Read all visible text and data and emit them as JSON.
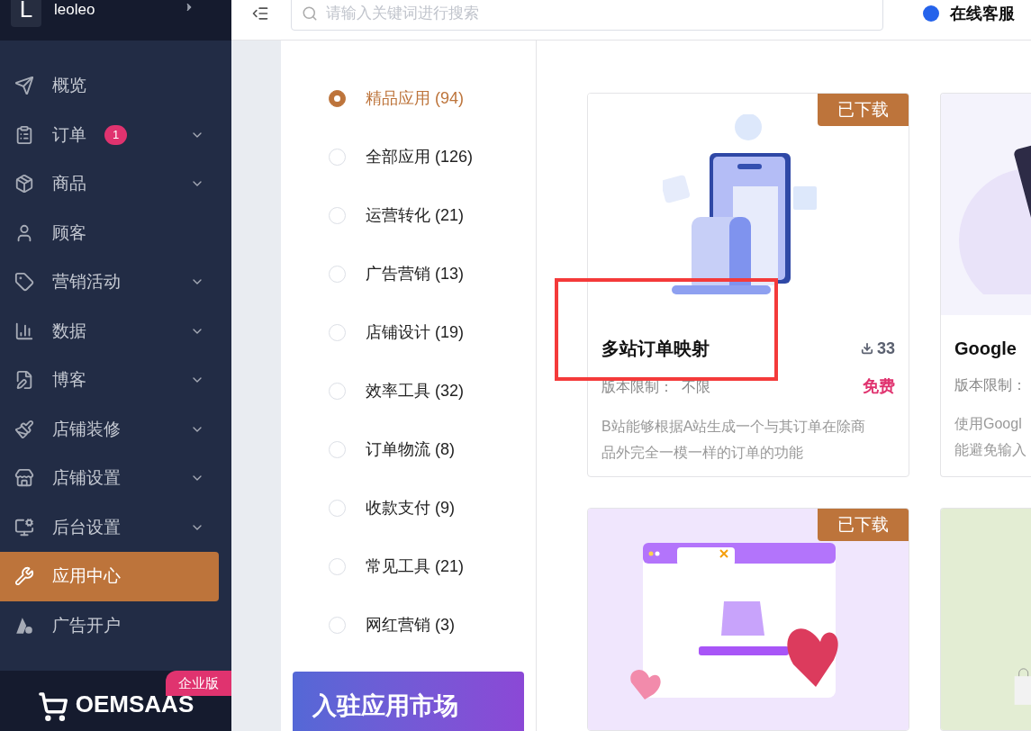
{
  "sidebar": {
    "brand": {
      "initial": "L",
      "name": "leoleo"
    },
    "items": [
      {
        "label": "概览",
        "expandable": false,
        "selected": false
      },
      {
        "label": "订单",
        "badge": "1",
        "expandable": true,
        "selected": false
      },
      {
        "label": "商品",
        "expandable": true,
        "selected": false
      },
      {
        "label": "顾客",
        "expandable": false,
        "selected": false
      },
      {
        "label": "营销活动",
        "expandable": true,
        "selected": false
      },
      {
        "label": "数据",
        "expandable": true,
        "selected": false
      },
      {
        "label": "博客",
        "expandable": true,
        "selected": false
      },
      {
        "label": "店铺装修",
        "expandable": true,
        "selected": false
      },
      {
        "label": "店铺设置",
        "expandable": true,
        "selected": false
      },
      {
        "label": "后台设置",
        "expandable": true,
        "selected": false
      },
      {
        "label": "应用中心",
        "expandable": false,
        "selected": true
      },
      {
        "label": "广告开户",
        "expandable": false,
        "selected": false
      }
    ],
    "footer": {
      "logo": "OEMSAAS",
      "badge": "企业版"
    }
  },
  "topbar": {
    "search": {
      "placeholder": "请输入关键词进行搜索"
    },
    "support": "在线客服"
  },
  "categories": [
    {
      "label": "精品应用 (94)",
      "selected": true
    },
    {
      "label": "全部应用 (126)",
      "selected": false
    },
    {
      "label": "运营转化 (21)",
      "selected": false
    },
    {
      "label": "广告营销 (13)",
      "selected": false
    },
    {
      "label": "店铺设计 (19)",
      "selected": false
    },
    {
      "label": "效率工具 (32)",
      "selected": false
    },
    {
      "label": "订单物流 (8)",
      "selected": false
    },
    {
      "label": "收款支付 (9)",
      "selected": false
    },
    {
      "label": "常见工具 (21)",
      "selected": false
    },
    {
      "label": "网红营销 (3)",
      "selected": false
    }
  ],
  "banner": "入驻应用市场",
  "apps": [
    {
      "kind": "receipt",
      "downloaded": true,
      "badge": "已下载",
      "title": "多站订单映射",
      "downloads": "33",
      "version": "版本限制：  不限",
      "price": "免费",
      "description": [
        "B站能够根据A站生成一个与其订单在除商",
        "品外完全一模一样的订单的功能"
      ]
    },
    {
      "kind": "phone",
      "title": "Google",
      "version": "版本限制：",
      "description": [
        "使用Googl",
        "能避免输入"
      ]
    },
    {
      "kind": "popup",
      "downloaded": true,
      "badge": "已下载"
    },
    {
      "kind": "bag"
    }
  ]
}
